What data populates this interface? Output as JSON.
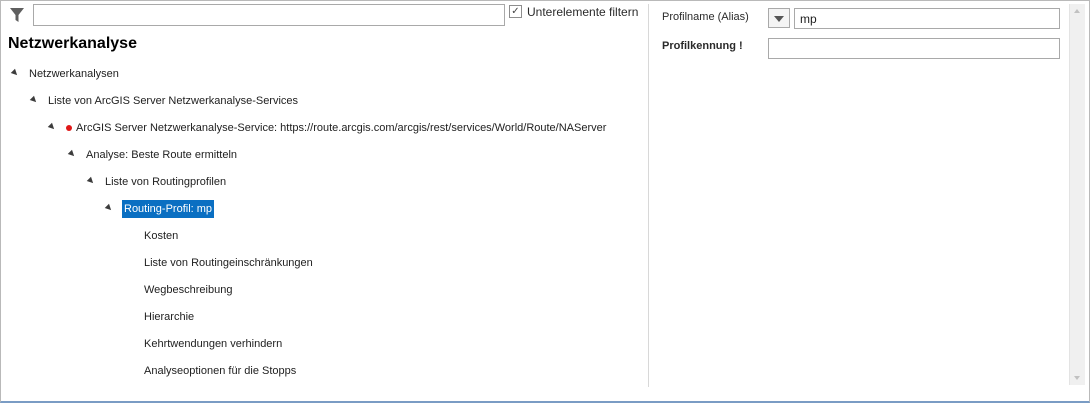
{
  "filter": {
    "icon": "filter-icon",
    "value": "",
    "placeholder": "",
    "subelements_label": "Unterelemente filtern",
    "subelements_checked": true
  },
  "panel": {
    "title": "Netzwerkanalyse"
  },
  "tree": [
    {
      "label": "Netzwerkanalysen",
      "expanded": true,
      "level": 0
    },
    {
      "label": "Liste von ArcGIS Server Netzwerkanalyse-Services",
      "expanded": true,
      "level": 1
    },
    {
      "label": "ArcGIS Server Netzwerkanalyse-Service: https://route.arcgis.com/arcgis/rest/services/World/Route/NAServer",
      "expanded": true,
      "level": 2,
      "error": true
    },
    {
      "label": "Analyse: Beste Route ermitteln",
      "expanded": true,
      "level": 3
    },
    {
      "label": "Liste von Routingprofilen",
      "expanded": true,
      "level": 4
    },
    {
      "label": "Routing-Profil: mp",
      "expanded": true,
      "level": 5,
      "selected": true
    },
    {
      "label": "Kosten",
      "level": 6
    },
    {
      "label": "Liste von Routingeinschränkungen",
      "level": 6
    },
    {
      "label": "Wegbeschreibung",
      "level": 6
    },
    {
      "label": "Hierarchie",
      "level": 6
    },
    {
      "label": "Kehrtwendungen verhindern",
      "level": 6
    },
    {
      "label": "Analyseoptionen für die Stopps",
      "level": 6
    }
  ],
  "properties": {
    "profilename_label": "Profilname (Alias)",
    "profilename_value": "mp",
    "profilkennung_label": "Profilkennung !",
    "profilkennung_value": ""
  },
  "colors": {
    "selection": "#0a6fc2",
    "error": "#e01818"
  }
}
